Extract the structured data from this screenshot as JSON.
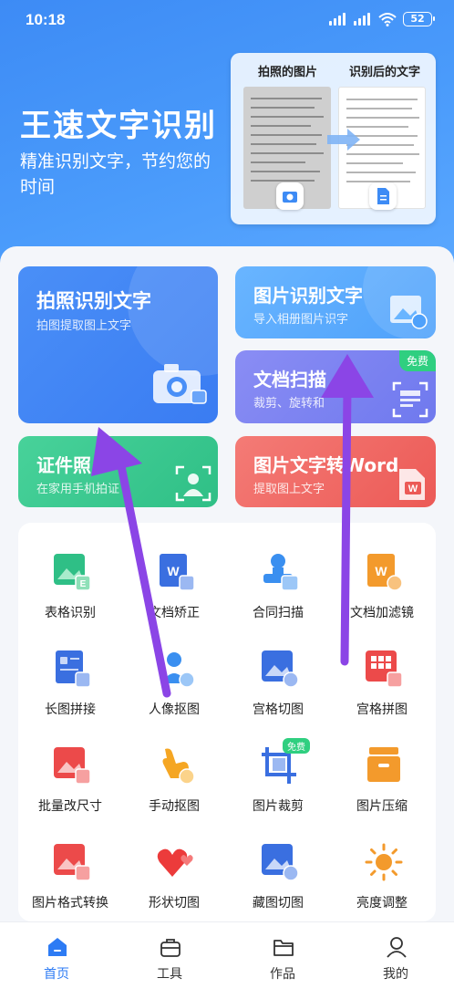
{
  "status": {
    "time": "10:18",
    "battery": "52"
  },
  "hero": {
    "title": "王速文字识别",
    "subtitle": "精准识别文字，节约您的时间",
    "compare_left": "拍照的图片",
    "compare_right": "识别后的文字"
  },
  "features": [
    {
      "title": "拍照识别文字",
      "subtitle": "拍图提取图上文字"
    },
    {
      "title": "图片识别文字",
      "subtitle": "导入相册图片识字"
    },
    {
      "title": "文档扫描",
      "subtitle": "裁剪、旋转和",
      "tag": "免费"
    },
    {
      "title": "证件照",
      "subtitle": "在家用手机拍证"
    },
    {
      "title": "图片文字转Word",
      "subtitle": "提取图上文字"
    }
  ],
  "tools": [
    {
      "label": "表格识别",
      "icon": "table-recognition-icon"
    },
    {
      "label": "文档矫正",
      "icon": "document-correction-icon"
    },
    {
      "label": "合同扫描",
      "icon": "contract-scan-icon"
    },
    {
      "label": "文档加滤镜",
      "icon": "document-filter-icon"
    },
    {
      "label": "长图拼接",
      "icon": "long-image-stitch-icon"
    },
    {
      "label": "人像抠图",
      "icon": "portrait-cutout-icon"
    },
    {
      "label": "宫格切图",
      "icon": "grid-cut-icon"
    },
    {
      "label": "宫格拼图",
      "icon": "grid-puzzle-icon"
    },
    {
      "label": "批量改尺寸",
      "icon": "batch-resize-icon"
    },
    {
      "label": "手动抠图",
      "icon": "manual-cutout-icon"
    },
    {
      "label": "图片裁剪",
      "icon": "image-crop-icon",
      "tag": "免费"
    },
    {
      "label": "图片压缩",
      "icon": "image-compress-icon"
    },
    {
      "label": "图片格式转换",
      "icon": "format-convert-icon"
    },
    {
      "label": "形状切图",
      "icon": "shape-cut-icon"
    },
    {
      "label": "藏图切图",
      "icon": "hidden-image-cut-icon"
    },
    {
      "label": "亮度调整",
      "icon": "brightness-icon"
    }
  ],
  "nav": [
    {
      "label": "首页",
      "icon": "home-icon",
      "active": true
    },
    {
      "label": "工具",
      "icon": "toolbox-icon"
    },
    {
      "label": "作品",
      "icon": "folder-icon"
    },
    {
      "label": "我的",
      "icon": "profile-icon"
    }
  ],
  "colors": {
    "accent": "#2d7bf4",
    "annotation_arrow": "#8b45e6"
  }
}
